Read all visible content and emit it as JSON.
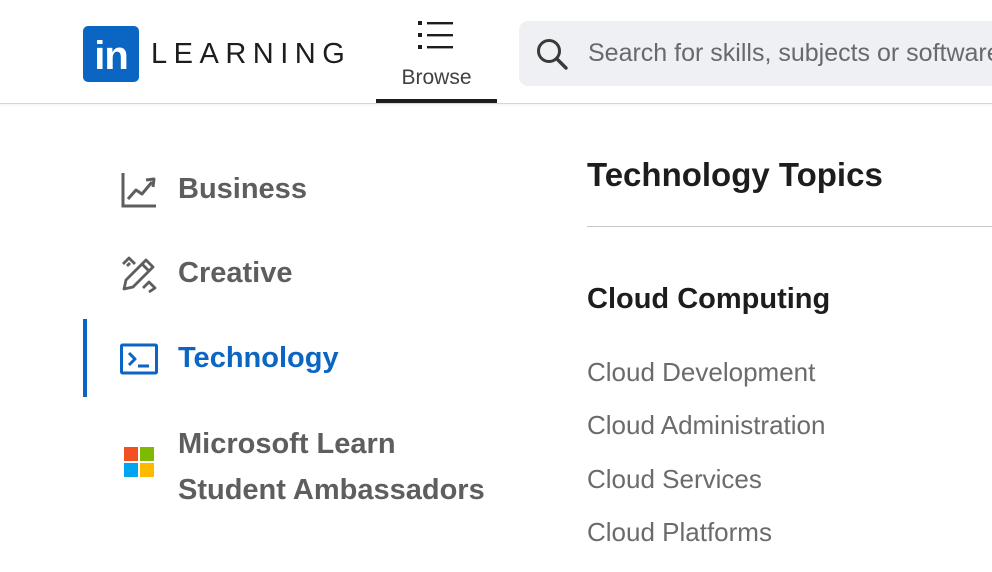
{
  "header": {
    "logo_badge": "in",
    "logo_word": "LEARNING",
    "browse_label": "Browse",
    "search_placeholder": "Search for skills, subjects or software"
  },
  "categories": [
    {
      "label": "Business",
      "icon": "trend-chart-icon",
      "active": false
    },
    {
      "label": "Creative",
      "icon": "pencil-ruler-icon",
      "active": false
    },
    {
      "label": "Technology",
      "icon": "terminal-icon",
      "active": true
    },
    {
      "label_line1": "Microsoft Learn",
      "label_line2": "Student Ambassadors",
      "icon": "microsoft-logo-icon",
      "active": false
    }
  ],
  "topics": {
    "title": "Technology Topics",
    "section": {
      "title": "Cloud Computing",
      "links": [
        "Cloud Development",
        "Cloud Administration",
        "Cloud Services",
        "Cloud Platforms"
      ]
    }
  },
  "colors": {
    "brand": "#0a66c2",
    "text_dark": "#1d1d1d",
    "text_muted": "#5e5e5e",
    "link_muted": "#6b6b6b",
    "search_bg": "#eef0f3"
  }
}
